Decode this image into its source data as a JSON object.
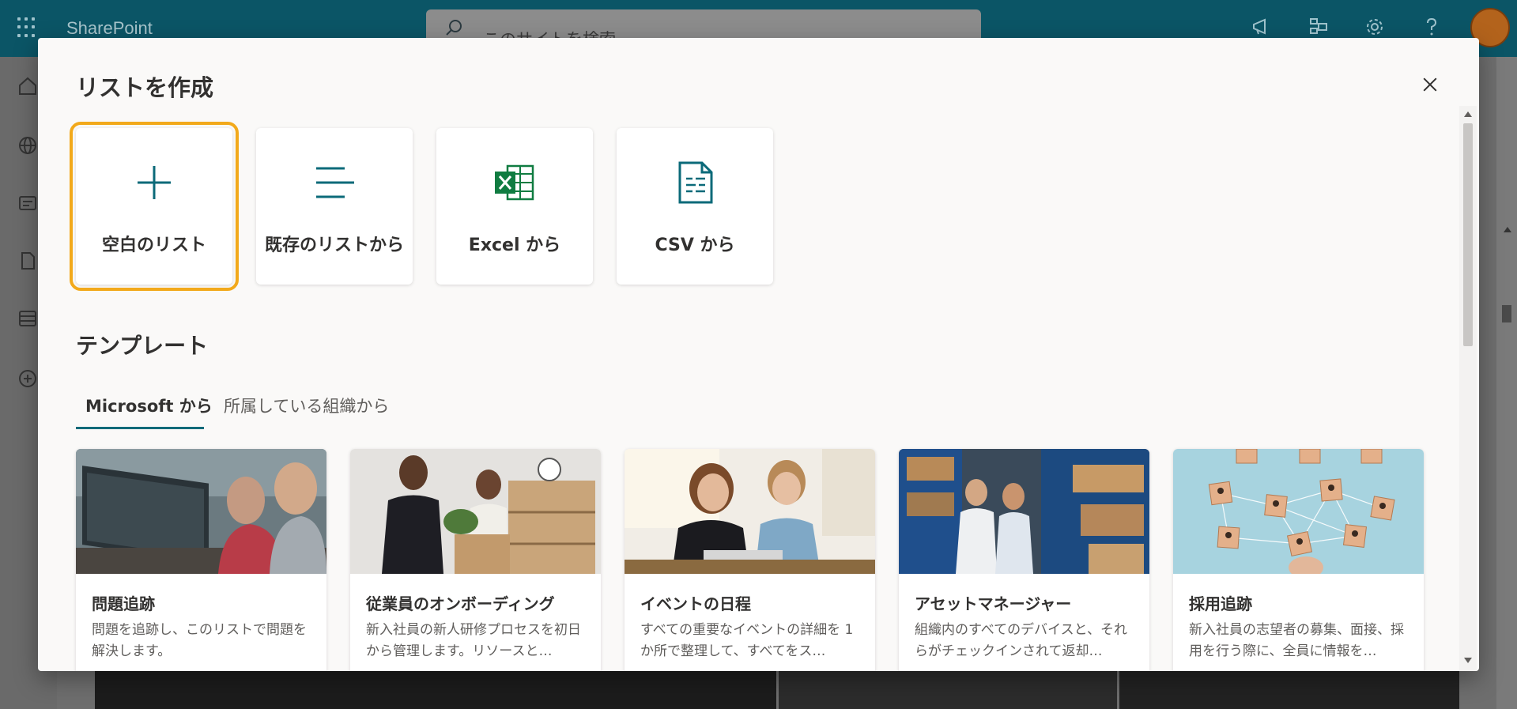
{
  "suite": {
    "app_name": "SharePoint",
    "search_placeholder": "このサイトを検索"
  },
  "dialog": {
    "title": "リストを作成",
    "close_icon": "close-icon",
    "create_options": [
      {
        "label": "空白のリスト",
        "icon": "plus-icon",
        "selected": true
      },
      {
        "label": "既存のリストから",
        "icon": "list-lines-icon",
        "selected": false
      },
      {
        "label": "Excel から",
        "icon": "excel-icon",
        "selected": false
      },
      {
        "label": "CSV から",
        "icon": "csv-file-icon",
        "selected": false
      }
    ],
    "templates_heading": "テンプレート",
    "tabs": [
      {
        "label": "Microsoft から",
        "active": true
      },
      {
        "label": "所属している組織から",
        "active": false
      }
    ],
    "templates": [
      {
        "title": "問題追跡",
        "description": "問題を追跡し、このリストで問題を解決します。"
      },
      {
        "title": "従業員のオンボーディング",
        "description": "新入社員の新人研修プロセスを初日から管理します。リソースと…"
      },
      {
        "title": "イベントの日程",
        "description": "すべての重要なイベントの詳細を 1 か所で整理して、すべてをス…"
      },
      {
        "title": "アセットマネージャー",
        "description": "組織内のすべてのデバイスと、それらがチェックインされて返却…"
      },
      {
        "title": "採用追跡",
        "description": "新入社員の志望者の募集、面接、採用を行う際に、全員に情報を…"
      }
    ]
  },
  "colors": {
    "accent_teal": "#0b6a79",
    "selection_outline": "#f2a91b",
    "excel_green": "#107c41"
  }
}
